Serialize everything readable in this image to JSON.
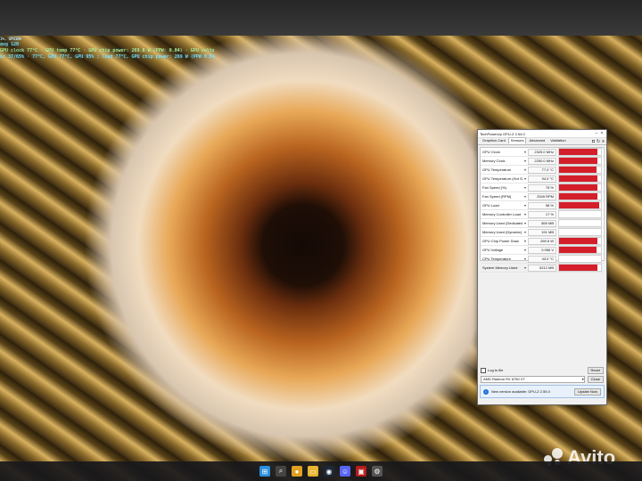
{
  "osd": {
    "header": "1%, GPU10%",
    "line1": "avg 120",
    "line2": "GPU clock 77°C · GPU temp 77°C · GPU chip power: 269.8 W (PPW: 0.84) · GPU voltage: 0.962 V",
    "line3": "ur 37/65%  · 77°C, GPU 77°C, GPU 95% ; load 77°C, GPU chip power: 269 W (PPW 0.84), fps 76%"
  },
  "gpuz": {
    "title": "TechPowerUp GPU-Z 2.54.0",
    "tabs": [
      {
        "label": "Graphics Card",
        "active": false
      },
      {
        "label": "Sensors",
        "active": true
      },
      {
        "label": "Advanced",
        "active": false
      },
      {
        "label": "Validation",
        "active": false
      }
    ],
    "icons": [
      "camera-icon",
      "refresh-icon",
      "menu-icon"
    ],
    "sensors": [
      {
        "name": "GPU Clock",
        "value": "2325.0 MHz",
        "level": 0.92
      },
      {
        "name": "Memory Clock",
        "value": "2250.0 MHz",
        "level": 0.92
      },
      {
        "name": "GPU Temperature",
        "value": "77.0 °C",
        "level": 0.9
      },
      {
        "name": "GPU Temperature (Hot Spot)",
        "value": "94.0 °C",
        "level": 0.92
      },
      {
        "name": "Fan Speed (%)",
        "value": "75 %",
        "level": 0.92
      },
      {
        "name": "Fan Speed (RPM)",
        "value": "2549 RPM",
        "level": 0.92
      },
      {
        "name": "GPU Load",
        "value": "98 %",
        "level": 0.95
      },
      {
        "name": "Memory Controller Load",
        "value": "17 %",
        "level": 0.0
      },
      {
        "name": "Memory Used (Dedicated)",
        "value": "859 MB",
        "level": 0.0
      },
      {
        "name": "Memory Used (Dynamic)",
        "value": "191 MB",
        "level": 0.0
      },
      {
        "name": "GPU Chip Power Draw",
        "value": "269.5 W",
        "level": 0.92
      },
      {
        "name": "GPU Voltage",
        "value": "0.956 V",
        "level": 0.9
      },
      {
        "name": "CPU Temperature",
        "value": "43.0 °C",
        "level": 0.0
      },
      {
        "name": "System Memory Used",
        "value": "5212 MB",
        "level": 0.92
      }
    ],
    "log_label": "Log to file",
    "reset_label": "Reset",
    "gpu_select": "AMD Radeon RX 6750 XT",
    "close_label": "Close",
    "notify_text": "New version available: GPU-Z 2.55.0",
    "update_label": "Update Now"
  },
  "watermark": "Avito",
  "taskbar": [
    "windows-icon",
    "search-icon",
    "chrome-icon",
    "explorer-icon",
    "steam-icon",
    "discord-icon",
    "gpuz-icon",
    "settings-icon"
  ],
  "colors": {
    "graph": "#d41f2b",
    "osd": "#9ef0ff"
  }
}
